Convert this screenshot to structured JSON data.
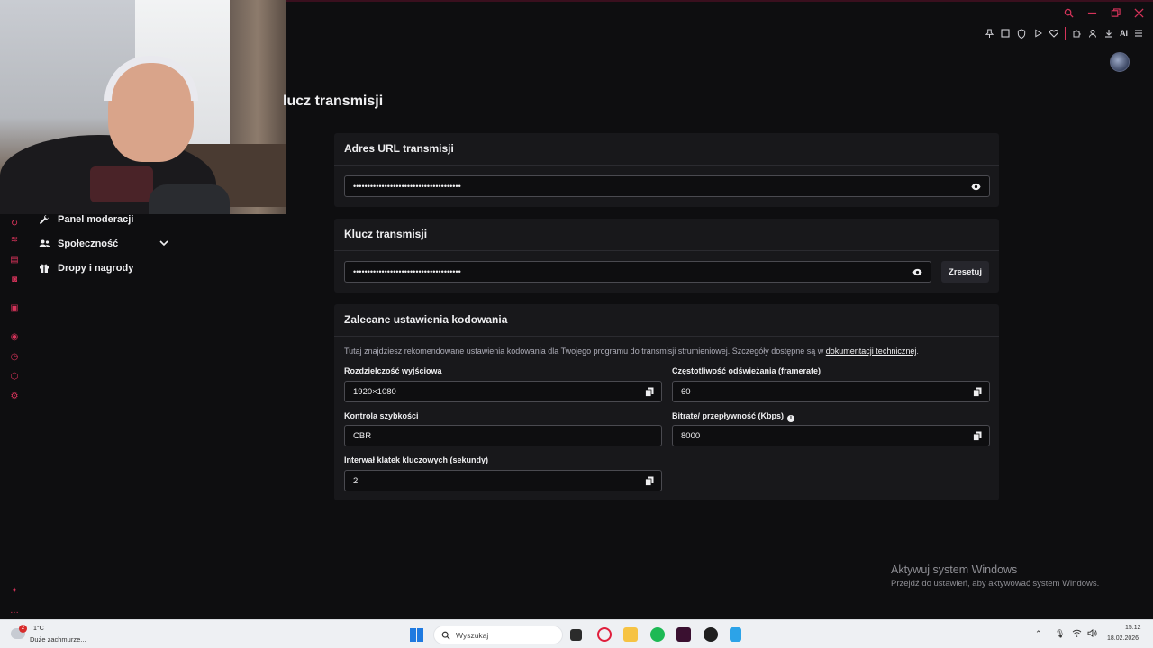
{
  "page": {
    "title": "lucz transmisji"
  },
  "toolbar": {
    "ai_label": "AI"
  },
  "sidebar": {
    "items": [
      {
        "label": "Panel moderacji",
        "icon": "wrench-icon"
      },
      {
        "label": "Społeczność",
        "icon": "users-icon"
      },
      {
        "label": "Dropy i nagrody",
        "icon": "gift-icon"
      }
    ]
  },
  "stream_url": {
    "title": "Adres URL transmisji",
    "masked_value": "••••••••••••••••••••••••••••••••••••••"
  },
  "stream_key": {
    "title": "Klucz transmisji",
    "masked_value": "••••••••••••••••••••••••••••••••••••••",
    "reset_label": "Zresetuj"
  },
  "encoding": {
    "title": "Zalecane ustawienia kodowania",
    "description": "Tutaj znajdziesz rekomendowane ustawienia kodowania dla Twojego programu do transmisji strumieniowej. Szczegóły dostępne są w ",
    "doc_link": "dokumentacji technicznej",
    "description_end": ".",
    "fields": {
      "resolution": {
        "label": "Rozdzielczość wyjściowa",
        "value": "1920×1080"
      },
      "framerate": {
        "label": "Częstotliwość odświeżania (framerate)",
        "value": "60"
      },
      "rate_control": {
        "label": "Kontrola szybkości",
        "value": "CBR"
      },
      "bitrate": {
        "label": "Bitrate/ przepływność (Kbps)",
        "value": "8000"
      },
      "keyframe": {
        "label": "Interwał klatek kluczowych (sekundy)",
        "value": "2"
      }
    }
  },
  "windows_activation": {
    "title": "Aktywuj system Windows",
    "subtitle": "Przejdź do ustawień, aby aktywować system Windows."
  },
  "taskbar": {
    "weather_temp": "1°C",
    "weather_condition": "Duże zachmurze...",
    "weather_badge": "2",
    "search_placeholder": "Wyszukaj",
    "time": "15:12",
    "date": "18.02.2026"
  },
  "colors": {
    "accent": "#d6335a",
    "background": "#0e0e10",
    "card": "#18181b",
    "input_border": "#4a4a50",
    "taskbar": "#eef0f3"
  }
}
